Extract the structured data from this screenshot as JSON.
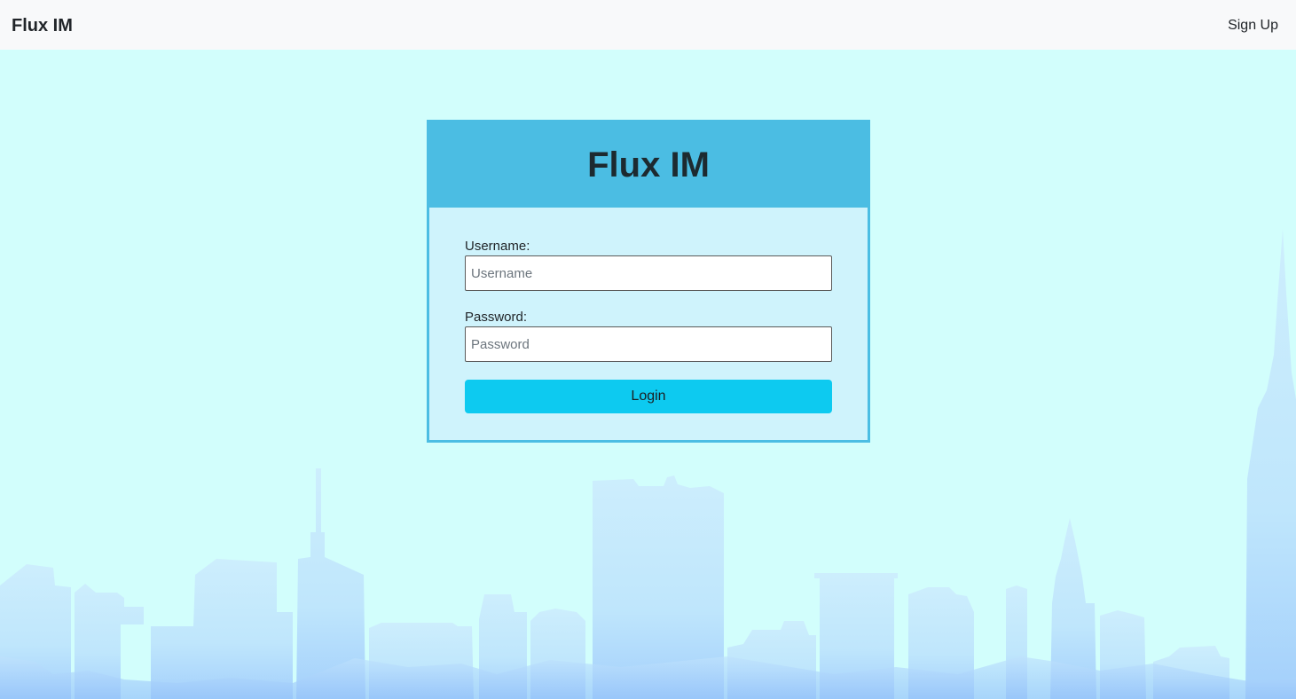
{
  "navbar": {
    "brand": "Flux IM",
    "signup_label": "Sign Up"
  },
  "login_card": {
    "title": "Flux IM",
    "username_label": "Username:",
    "username_placeholder": "Username",
    "username_value": "",
    "password_label": "Password:",
    "password_placeholder": "Password",
    "password_value": "",
    "login_label": "Login"
  },
  "colors": {
    "page_background": "#d2fefc",
    "navbar_background": "#f8f9fa",
    "card_header": "#4bbde3",
    "card_body": "#cff3fc",
    "login_button": "#0dcaf0",
    "skyline_top": "#cfeefd",
    "skyline_bottom": "#9ecbfb"
  }
}
